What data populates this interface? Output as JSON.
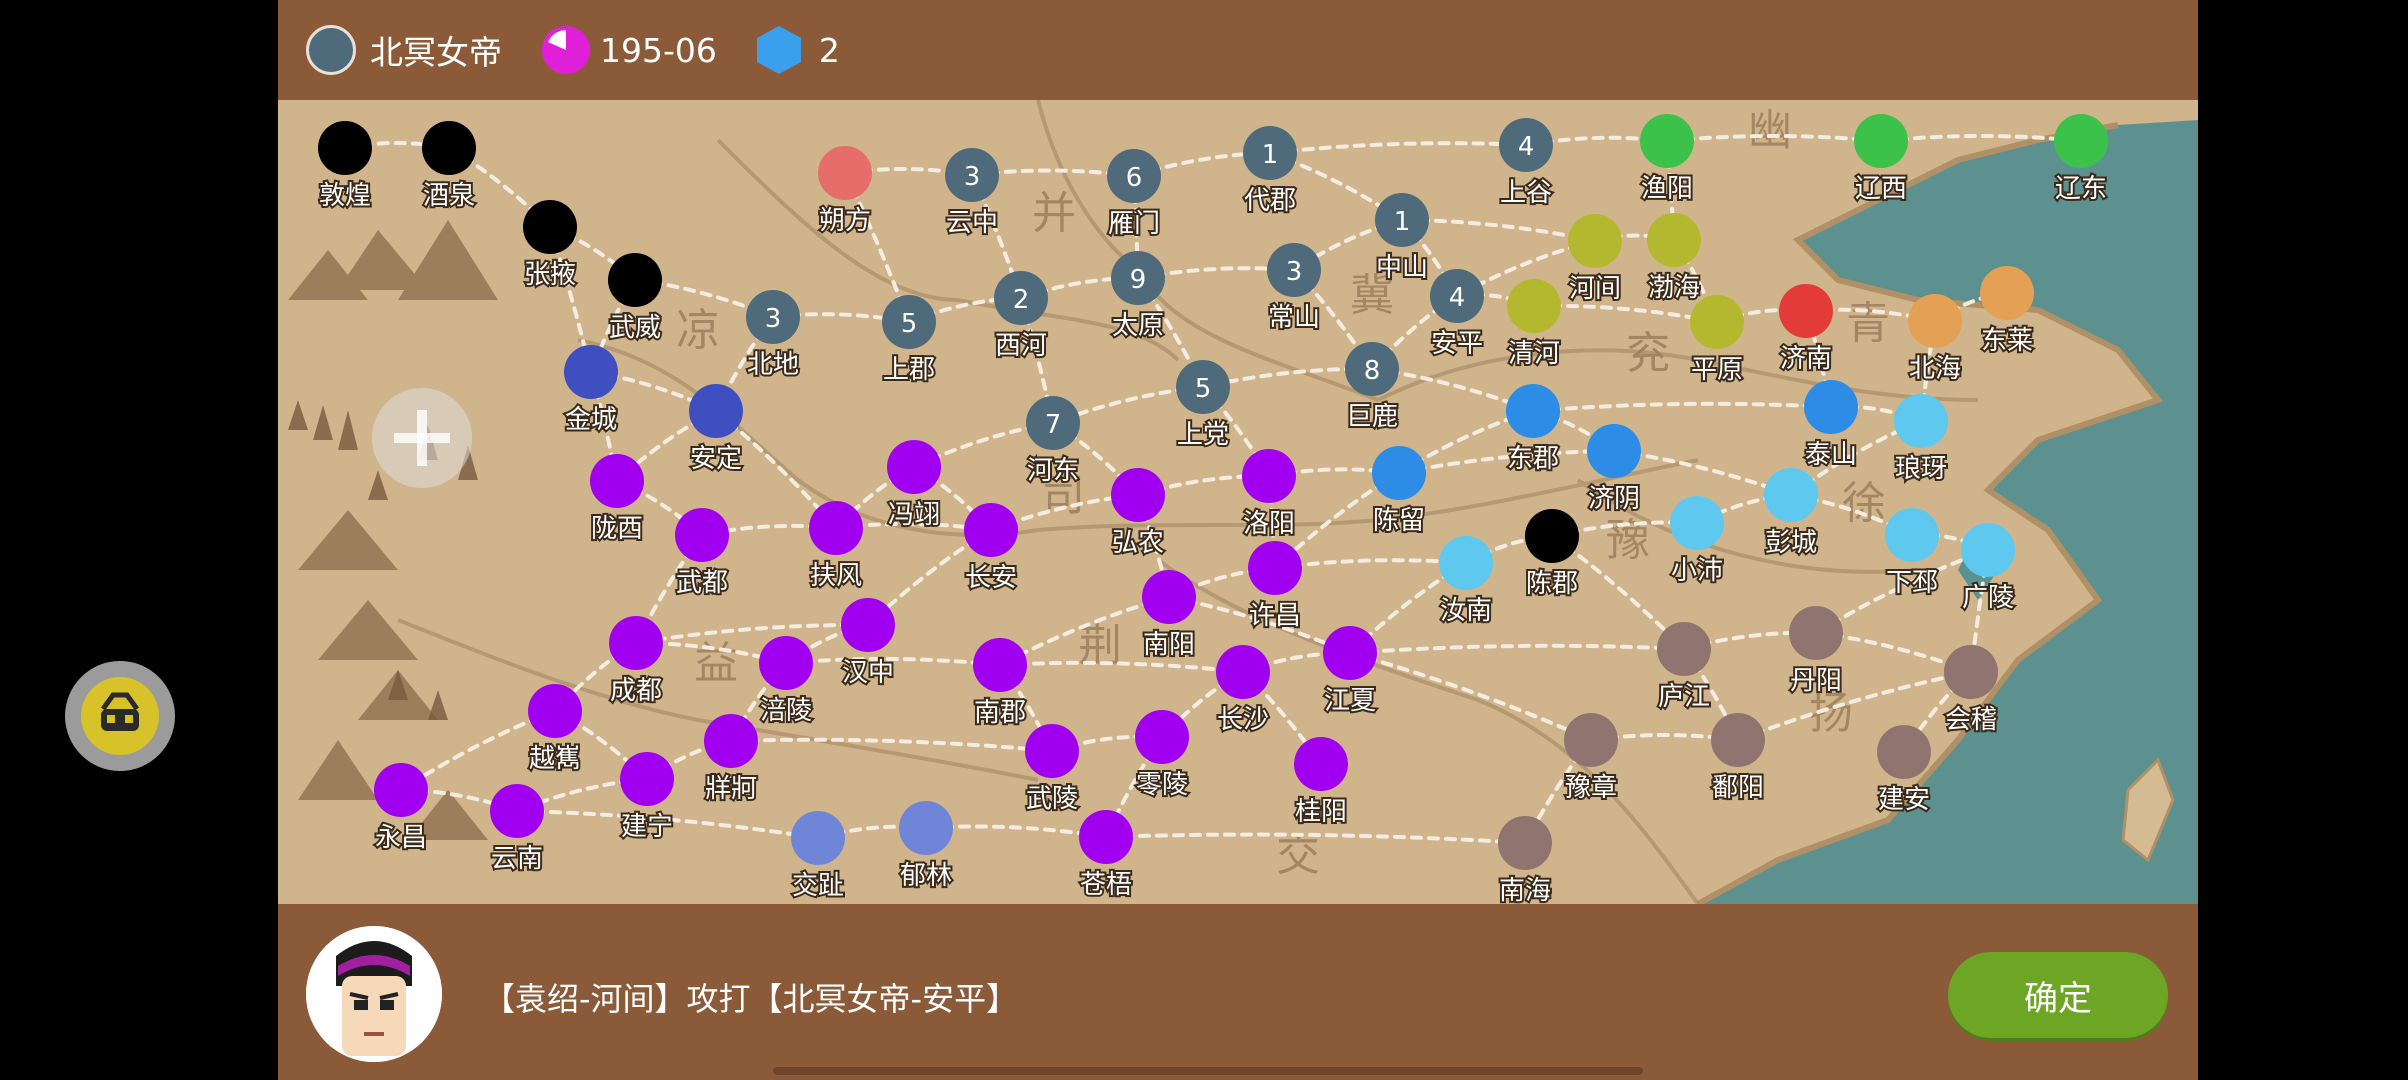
{
  "hud": {
    "faction_name": "北冥女帝",
    "date": "195-06",
    "gems": "2",
    "faction_color": "#4f6b7b",
    "date_icon_color": "#e020d8",
    "gem_icon_color": "#3aa0ee"
  },
  "bottom": {
    "message": "【袁绍-河间】攻打【北冥女帝-安平】",
    "confirm_label": "确定"
  },
  "regions": [
    "幽",
    "并",
    "凉",
    "冀",
    "青",
    "兖",
    "司",
    "豫",
    "徐",
    "益",
    "荆",
    "扬",
    "交"
  ],
  "cities": [
    {
      "name": "敦煌",
      "color": "#000000",
      "troops": ""
    },
    {
      "name": "酒泉",
      "color": "#000000",
      "troops": ""
    },
    {
      "name": "张掖",
      "color": "#000000",
      "troops": ""
    },
    {
      "name": "武威",
      "color": "#000000",
      "troops": ""
    },
    {
      "name": "朔方",
      "color": "#e76d6b",
      "troops": ""
    },
    {
      "name": "云中",
      "color": "#4f6b7b",
      "troops": "3"
    },
    {
      "name": "雁门",
      "color": "#4f6b7b",
      "troops": "6"
    },
    {
      "name": "代郡",
      "color": "#4f6b7b",
      "troops": "1"
    },
    {
      "name": "上谷",
      "color": "#4f6b7b",
      "troops": "4"
    },
    {
      "name": "渔阳",
      "color": "#3cc24a",
      "troops": ""
    },
    {
      "name": "辽西",
      "color": "#3cc24a",
      "troops": ""
    },
    {
      "name": "辽东",
      "color": "#3cc24a",
      "troops": ""
    },
    {
      "name": "中山",
      "color": "#4f6b7b",
      "troops": "1"
    },
    {
      "name": "河间",
      "color": "#b4b82e",
      "troops": ""
    },
    {
      "name": "渤海",
      "color": "#b4b82e",
      "troops": ""
    },
    {
      "name": "北地",
      "color": "#4f6b7b",
      "troops": "3"
    },
    {
      "name": "上郡",
      "color": "#4f6b7b",
      "troops": "5"
    },
    {
      "name": "西河",
      "color": "#4f6b7b",
      "troops": "2"
    },
    {
      "name": "太原",
      "color": "#4f6b7b",
      "troops": "9"
    },
    {
      "name": "常山",
      "color": "#4f6b7b",
      "troops": "3"
    },
    {
      "name": "安平",
      "color": "#4f6b7b",
      "troops": "4"
    },
    {
      "name": "清河",
      "color": "#b4b82e",
      "troops": ""
    },
    {
      "name": "平原",
      "color": "#b4b82e",
      "troops": ""
    },
    {
      "name": "济南",
      "color": "#e33a3a",
      "troops": ""
    },
    {
      "name": "北海",
      "color": "#e4a055",
      "troops": ""
    },
    {
      "name": "东莱",
      "color": "#e4a055",
      "troops": ""
    },
    {
      "name": "金城",
      "color": "#3f4fc0",
      "troops": ""
    },
    {
      "name": "安定",
      "color": "#3f4fc0",
      "troops": ""
    },
    {
      "name": "上党",
      "color": "#4f6b7b",
      "troops": "5"
    },
    {
      "name": "巨鹿",
      "color": "#4f6b7b",
      "troops": "8"
    },
    {
      "name": "河东",
      "color": "#4f6b7b",
      "troops": "7"
    },
    {
      "name": "东郡",
      "color": "#2c8ce6",
      "troops": ""
    },
    {
      "name": "泰山",
      "color": "#2c8ce6",
      "troops": ""
    },
    {
      "name": "琅玡",
      "color": "#5ec8ee",
      "troops": ""
    },
    {
      "name": "陇西",
      "color": "#a100f0",
      "troops": ""
    },
    {
      "name": "冯翊",
      "color": "#a100f0",
      "troops": ""
    },
    {
      "name": "洛阳",
      "color": "#a100f0",
      "troops": ""
    },
    {
      "name": "陈留",
      "color": "#2c8ce6",
      "troops": ""
    },
    {
      "name": "济阴",
      "color": "#2c8ce6",
      "troops": ""
    },
    {
      "name": "彭城",
      "color": "#5ec8ee",
      "troops": ""
    },
    {
      "name": "武都",
      "color": "#a100f0",
      "troops": ""
    },
    {
      "name": "扶风",
      "color": "#a100f0",
      "troops": ""
    },
    {
      "name": "长安",
      "color": "#a100f0",
      "troops": ""
    },
    {
      "name": "弘农",
      "color": "#a100f0",
      "troops": ""
    },
    {
      "name": "许昌",
      "color": "#a100f0",
      "troops": ""
    },
    {
      "name": "汝南",
      "color": "#5ec8ee",
      "troops": ""
    },
    {
      "name": "陈郡",
      "color": "#000000",
      "troops": ""
    },
    {
      "name": "小沛",
      "color": "#5ec8ee",
      "troops": ""
    },
    {
      "name": "下邳",
      "color": "#5ec8ee",
      "troops": ""
    },
    {
      "name": "广陵",
      "color": "#5ec8ee",
      "troops": ""
    },
    {
      "name": "南阳",
      "color": "#a100f0",
      "troops": ""
    },
    {
      "name": "成都",
      "color": "#a100f0",
      "troops": ""
    },
    {
      "name": "汉中",
      "color": "#a100f0",
      "troops": ""
    },
    {
      "name": "涪陵",
      "color": "#a100f0",
      "troops": ""
    },
    {
      "name": "南郡",
      "color": "#a100f0",
      "troops": ""
    },
    {
      "name": "长沙",
      "color": "#a100f0",
      "troops": ""
    },
    {
      "name": "江夏",
      "color": "#a100f0",
      "troops": ""
    },
    {
      "name": "庐江",
      "color": "#8f7470",
      "troops": ""
    },
    {
      "name": "丹阳",
      "color": "#8f7470",
      "troops": ""
    },
    {
      "name": "会稽",
      "color": "#8f7470",
      "troops": ""
    },
    {
      "name": "越嶲",
      "color": "#a100f0",
      "troops": ""
    },
    {
      "name": "牂牁",
      "color": "#a100f0",
      "troops": ""
    },
    {
      "name": "永昌",
      "color": "#a100f0",
      "troops": ""
    },
    {
      "name": "建宁",
      "color": "#a100f0",
      "troops": ""
    },
    {
      "name": "云南",
      "color": "#a100f0",
      "troops": ""
    },
    {
      "name": "武陵",
      "color": "#a100f0",
      "troops": ""
    },
    {
      "name": "零陵",
      "color": "#a100f0",
      "troops": ""
    },
    {
      "name": "桂阳",
      "color": "#a100f0",
      "troops": ""
    },
    {
      "name": "豫章",
      "color": "#8f7470",
      "troops": ""
    },
    {
      "name": "鄱阳",
      "color": "#8f7470",
      "troops": ""
    },
    {
      "name": "建安",
      "color": "#8f7470",
      "troops": ""
    },
    {
      "name": "交趾",
      "color": "#6f86d8",
      "troops": ""
    },
    {
      "name": "郁林",
      "color": "#6f86d8",
      "troops": ""
    },
    {
      "name": "苍梧",
      "color": "#a100f0",
      "troops": ""
    },
    {
      "name": "南海",
      "color": "#8f7470",
      "troops": ""
    }
  ],
  "roads": [
    [
      "敦煌",
      "酒泉"
    ],
    [
      "酒泉",
      "张掖"
    ],
    [
      "张掖",
      "武威"
    ],
    [
      "张掖",
      "金城"
    ],
    [
      "武威",
      "北地"
    ],
    [
      "武威",
      "金城"
    ],
    [
      "金城",
      "安定"
    ],
    [
      "金城",
      "陇西"
    ],
    [
      "北地",
      "上郡"
    ],
    [
      "北地",
      "安定"
    ],
    [
      "上郡",
      "西河"
    ],
    [
      "上郡",
      "朔方"
    ],
    [
      "朔方",
      "云中"
    ],
    [
      "云中",
      "雁门"
    ],
    [
      "云中",
      "西河"
    ],
    [
      "雁门",
      "代郡"
    ],
    [
      "雁门",
      "太原"
    ],
    [
      "代郡",
      "上谷"
    ],
    [
      "代郡",
      "中山"
    ],
    [
      "上谷",
      "渔阳"
    ],
    [
      "渔阳",
      "辽西"
    ],
    [
      "辽西",
      "辽东"
    ],
    [
      "渔阳",
      "渤海"
    ],
    [
      "中山",
      "河间"
    ],
    [
      "中山",
      "常山"
    ],
    [
      "中山",
      "安平"
    ],
    [
      "河间",
      "渤海"
    ],
    [
      "河间",
      "安平"
    ],
    [
      "渤海",
      "平原"
    ],
    [
      "安平",
      "清河"
    ],
    [
      "清河",
      "平原"
    ],
    [
      "平原",
      "济南"
    ],
    [
      "济南",
      "北海"
    ],
    [
      "北海",
      "东莱"
    ],
    [
      "西河",
      "太原"
    ],
    [
      "太原",
      "常山"
    ],
    [
      "太原",
      "上党"
    ],
    [
      "常山",
      "巨鹿"
    ],
    [
      "巨鹿",
      "安平"
    ],
    [
      "巨鹿",
      "东郡"
    ],
    [
      "巨鹿",
      "上党"
    ],
    [
      "上党",
      "河东"
    ],
    [
      "上党",
      "洛阳"
    ],
    [
      "西河",
      "河东"
    ],
    [
      "河东",
      "冯翊"
    ],
    [
      "河东",
      "弘农"
    ],
    [
      "安定",
      "陇西"
    ],
    [
      "安定",
      "扶风"
    ],
    [
      "陇西",
      "武都"
    ],
    [
      "冯翊",
      "扶风"
    ],
    [
      "冯翊",
      "长安"
    ],
    [
      "扶风",
      "长安"
    ],
    [
      "扶风",
      "武都"
    ],
    [
      "长安",
      "弘农"
    ],
    [
      "长安",
      "汉中"
    ],
    [
      "弘农",
      "洛阳"
    ],
    [
      "弘农",
      "南阳"
    ],
    [
      "洛阳",
      "陈留"
    ],
    [
      "洛阳",
      "许昌"
    ],
    [
      "陈留",
      "东郡"
    ],
    [
      "陈留",
      "济阴"
    ],
    [
      "陈留",
      "许昌"
    ],
    [
      "东郡",
      "济阴"
    ],
    [
      "东郡",
      "泰山"
    ],
    [
      "泰山",
      "济南"
    ],
    [
      "泰山",
      "琅玡"
    ],
    [
      "琅玡",
      "北海"
    ],
    [
      "济阴",
      "彭城"
    ],
    [
      "彭城",
      "琅玡"
    ],
    [
      "彭城",
      "小沛"
    ],
    [
      "彭城",
      "下邳"
    ],
    [
      "下邳",
      "广陵"
    ],
    [
      "许昌",
      "汝南"
    ],
    [
      "许昌",
      "南阳"
    ],
    [
      "汝南",
      "陈郡"
    ],
    [
      "陈郡",
      "小沛"
    ],
    [
      "陈郡",
      "庐江"
    ],
    [
      "汝南",
      "江夏"
    ],
    [
      "南阳",
      "南郡"
    ],
    [
      "南阳",
      "江夏"
    ],
    [
      "武都",
      "成都"
    ],
    [
      "汉中",
      "成都"
    ],
    [
      "汉中",
      "涪陵"
    ],
    [
      "成都",
      "越嶲"
    ],
    [
      "成都",
      "涪陵"
    ],
    [
      "涪陵",
      "牂牁"
    ],
    [
      "涪陵",
      "南郡"
    ],
    [
      "南郡",
      "武陵"
    ],
    [
      "南郡",
      "长沙"
    ],
    [
      "长沙",
      "江夏"
    ],
    [
      "长沙",
      "零陵"
    ],
    [
      "长沙",
      "桂阳"
    ],
    [
      "江夏",
      "庐江"
    ],
    [
      "江夏",
      "豫章"
    ],
    [
      "庐江",
      "丹阳"
    ],
    [
      "丹阳",
      "会稽"
    ],
    [
      "丹阳",
      "广陵"
    ],
    [
      "庐江",
      "鄱阳"
    ],
    [
      "豫章",
      "鄱阳"
    ],
    [
      "鄱阳",
      "会稽"
    ],
    [
      "会稽",
      "建安"
    ],
    [
      "豫章",
      "南海"
    ],
    [
      "越嶲",
      "永昌"
    ],
    [
      "越嶲",
      "建宁"
    ],
    [
      "建宁",
      "云南"
    ],
    [
      "建宁",
      "牂牁"
    ],
    [
      "永昌",
      "云南"
    ],
    [
      "云南",
      "交趾"
    ],
    [
      "交趾",
      "郁林"
    ],
    [
      "郁林",
      "苍梧"
    ],
    [
      "苍梧",
      "南海"
    ],
    [
      "牂牁",
      "武陵"
    ],
    [
      "武陵",
      "零陵"
    ],
    [
      "零陵",
      "苍梧"
    ],
    [
      "广陵",
      "会稽"
    ]
  ]
}
